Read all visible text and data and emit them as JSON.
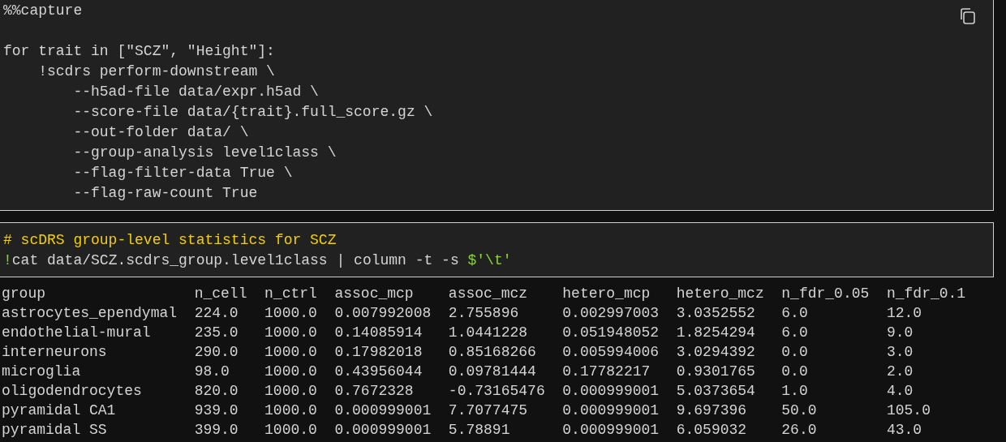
{
  "cells": [
    {
      "kind": "code",
      "lines": [
        {
          "kind": "text",
          "tokens": [
            {
              "kind": "plain",
              "text": "%%capture"
            }
          ]
        },
        {
          "kind": "blank"
        },
        {
          "kind": "text",
          "tokens": [
            {
              "kind": "plain",
              "text": "for trait in [\"SCZ\", \"Height\"]:"
            }
          ]
        },
        {
          "kind": "text",
          "tokens": [
            {
              "kind": "plain",
              "text": "    !scdrs perform-downstream \\"
            }
          ]
        },
        {
          "kind": "text",
          "tokens": [
            {
              "kind": "plain",
              "text": "        --h5ad-file data/expr.h5ad \\"
            }
          ]
        },
        {
          "kind": "text",
          "tokens": [
            {
              "kind": "plain",
              "text": "        --score-file data/{trait}.full_score.gz \\"
            }
          ]
        },
        {
          "kind": "text",
          "tokens": [
            {
              "kind": "plain",
              "text": "        --out-folder data/ \\"
            }
          ]
        },
        {
          "kind": "text",
          "tokens": [
            {
              "kind": "plain",
              "text": "        --group-analysis level1class \\"
            }
          ]
        },
        {
          "kind": "text",
          "tokens": [
            {
              "kind": "plain",
              "text": "        --flag-filter-data True \\"
            }
          ]
        },
        {
          "kind": "text",
          "tokens": [
            {
              "kind": "plain",
              "text": "        --flag-raw-count True"
            }
          ]
        }
      ]
    },
    {
      "kind": "code",
      "lines": [
        {
          "kind": "text",
          "tokens": [
            {
              "kind": "comment",
              "text": "# scDRS group-level statistics for SCZ"
            }
          ]
        },
        {
          "kind": "text",
          "tokens": [
            {
              "kind": "magic",
              "text": "!"
            },
            {
              "kind": "plain",
              "text": "cat data/SCZ.scdrs_group.level1class | column -t -s "
            },
            {
              "kind": "string",
              "text": "$'\\t'"
            }
          ]
        }
      ]
    },
    {
      "kind": "table",
      "columns": [
        "group",
        "n_cell",
        "n_ctrl",
        "assoc_mcp",
        "assoc_mcz",
        "hetero_mcp",
        "hetero_mcz",
        "n_fdr_0.05",
        "n_fdr_0.1"
      ],
      "rows": [
        [
          "astrocytes_ependymal",
          "224.0",
          "1000.0",
          "0.007992008",
          "2.755896",
          "0.002997003",
          "3.0352552",
          "6.0",
          "12.0"
        ],
        [
          "endothelial-mural",
          "235.0",
          "1000.0",
          "0.14085914",
          "1.0441228",
          "0.051948052",
          "1.8254294",
          "6.0",
          "9.0"
        ],
        [
          "interneurons",
          "290.0",
          "1000.0",
          "0.17982018",
          "0.85168266",
          "0.005994006",
          "3.0294392",
          "0.0",
          "3.0"
        ],
        [
          "microglia",
          "98.0",
          "1000.0",
          "0.43956044",
          "0.09781444",
          "0.17782217",
          "0.9301765",
          "0.0",
          "2.0"
        ],
        [
          "oligodendrocytes",
          "820.0",
          "1000.0",
          "0.7672328",
          "-0.73165476",
          "0.000999001",
          "5.0373654",
          "1.0",
          "4.0"
        ],
        [
          "pyramidal CA1",
          "939.0",
          "1000.0",
          "0.000999001",
          "7.7077475",
          "0.000999001",
          "9.697396",
          "50.0",
          "105.0"
        ],
        [
          "pyramidal SS",
          "399.0",
          "1000.0",
          "0.000999001",
          "5.78891",
          "0.000999001",
          "6.059032",
          "26.0",
          "43.0"
        ]
      ]
    }
  ]
}
